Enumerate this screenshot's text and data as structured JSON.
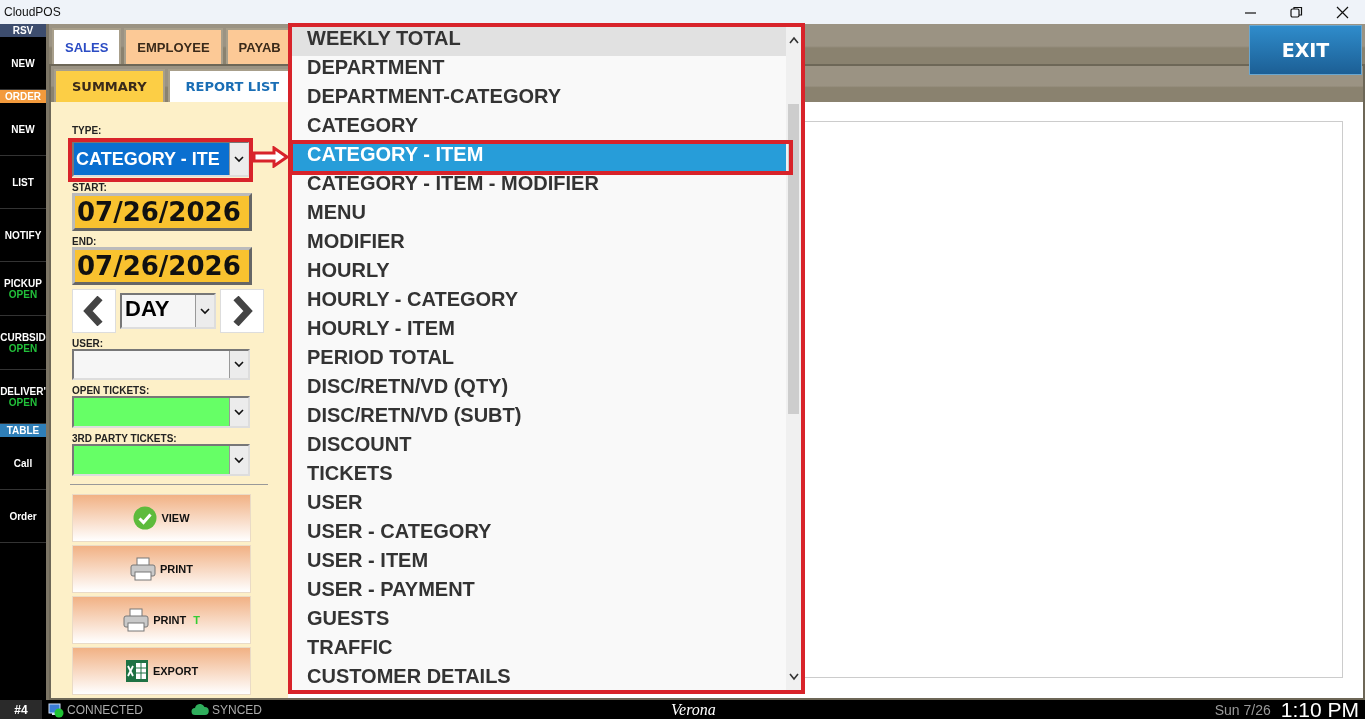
{
  "window": {
    "title": "CloudPOS"
  },
  "sidebar": {
    "items": [
      {
        "kind": "header",
        "label": "RSV",
        "color": "#3d4d6e"
      },
      {
        "kind": "button",
        "label": "NEW"
      },
      {
        "kind": "header",
        "label": "ORDER",
        "color": "#f39a3c"
      },
      {
        "kind": "button",
        "label": "NEW"
      },
      {
        "kind": "button",
        "label": "LIST"
      },
      {
        "kind": "button",
        "label": "NOTIFY"
      },
      {
        "kind": "button",
        "label": "PICKUP",
        "status": "OPEN"
      },
      {
        "kind": "button",
        "label": "CURBSID",
        "status": "OPEN"
      },
      {
        "kind": "button",
        "label": "DELIVER'",
        "status": "OPEN"
      },
      {
        "kind": "header",
        "label": "TABLE",
        "color": "#2f7fb8"
      },
      {
        "kind": "button",
        "label": "Call"
      },
      {
        "kind": "button",
        "label": "Order"
      }
    ]
  },
  "tabs": [
    {
      "label": "SALES",
      "selected": true
    },
    {
      "label": "EMPLOYEE",
      "selected": false
    },
    {
      "label": "PAYAB",
      "selected": false
    }
  ],
  "subtabs": [
    {
      "label": "SUMMARY",
      "selected": false
    },
    {
      "label": "REPORT LIST",
      "selected": true
    }
  ],
  "exit_button": "EXIT",
  "filters": {
    "type": {
      "label": "TYPE:",
      "value": "CATEGORY - ITE"
    },
    "start": {
      "label": "START:",
      "value": "07/26/2026"
    },
    "end": {
      "label": "END:",
      "value": "07/26/2026"
    },
    "period": {
      "value": "DAY"
    },
    "user": {
      "label": "USER:"
    },
    "open_tickets": {
      "label": "OPEN TICKETS:"
    },
    "third_party_tickets": {
      "label": "3RD PARTY TICKETS:"
    }
  },
  "actions": [
    {
      "kind": "view",
      "label": "VIEW"
    },
    {
      "kind": "print",
      "label": "PRINT"
    },
    {
      "kind": "print",
      "label": "PRINT",
      "suffix": "T"
    },
    {
      "kind": "export",
      "label": "EXPORT"
    }
  ],
  "dropdown": {
    "items": [
      {
        "label": "WEEKLY TOTAL",
        "selected": false,
        "hovered": true
      },
      {
        "label": "DEPARTMENT",
        "selected": false,
        "hovered": false
      },
      {
        "label": "DEPARTMENT-CATEGORY",
        "selected": false,
        "hovered": false
      },
      {
        "label": "CATEGORY",
        "selected": false,
        "hovered": false
      },
      {
        "label": "CATEGORY - ITEM",
        "selected": true,
        "hovered": false
      },
      {
        "label": "CATEGORY - ITEM - MODIFIER",
        "selected": false,
        "hovered": false
      },
      {
        "label": "MENU",
        "selected": false,
        "hovered": false
      },
      {
        "label": "MODIFIER",
        "selected": false,
        "hovered": false
      },
      {
        "label": "HOURLY",
        "selected": false,
        "hovered": false
      },
      {
        "label": "HOURLY - CATEGORY",
        "selected": false,
        "hovered": false
      },
      {
        "label": "HOURLY - ITEM",
        "selected": false,
        "hovered": false
      },
      {
        "label": "PERIOD TOTAL",
        "selected": false,
        "hovered": false
      },
      {
        "label": "DISC/RETN/VD (QTY)",
        "selected": false,
        "hovered": false
      },
      {
        "label": "DISC/RETN/VD (SUBT)",
        "selected": false,
        "hovered": false
      },
      {
        "label": "DISCOUNT",
        "selected": false,
        "hovered": false
      },
      {
        "label": "TICKETS",
        "selected": false,
        "hovered": false
      },
      {
        "label": "USER",
        "selected": false,
        "hovered": false
      },
      {
        "label": "USER - CATEGORY",
        "selected": false,
        "hovered": false
      },
      {
        "label": "USER - ITEM",
        "selected": false,
        "hovered": false
      },
      {
        "label": "USER - PAYMENT",
        "selected": false,
        "hovered": false
      },
      {
        "label": "GUESTS",
        "selected": false,
        "hovered": false
      },
      {
        "label": "TRAFFIC",
        "selected": false,
        "hovered": false
      },
      {
        "label": "CUSTOMER DETAILS",
        "selected": false,
        "hovered": false
      }
    ]
  },
  "status_bar": {
    "station": "#4",
    "connection": "CONNECTED",
    "sync": "SYNCED",
    "location": "Verona",
    "date": "Sun 7/26",
    "time": "1:10 PM"
  }
}
